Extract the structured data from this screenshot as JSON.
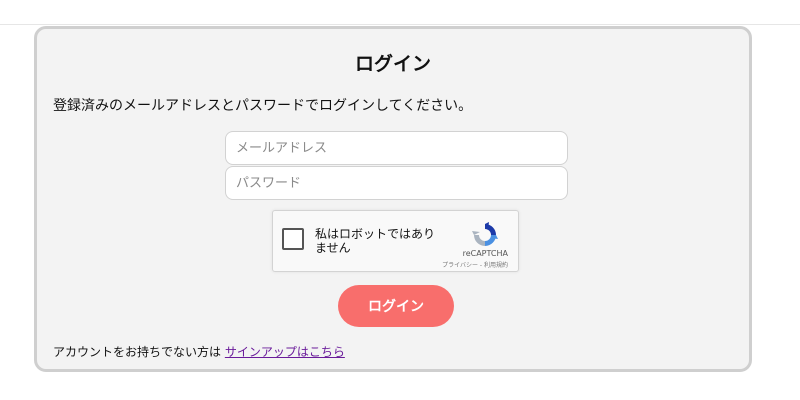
{
  "login": {
    "title": "ログイン",
    "description": "登録済みのメールアドレスとパスワードでログインしてください。",
    "email_placeholder": "メールアドレス",
    "password_placeholder": "パスワード",
    "submit_label": "ログイン",
    "signup_prompt": "アカウントをお持ちでない方は",
    "signup_link": "サインアップはこちら"
  },
  "captcha": {
    "label": "私はロボットではありません",
    "brand": "reCAPTCHA",
    "links": "プライバシー - 利用規約",
    "logo_icon": "recaptcha-logo-icon"
  },
  "colors": {
    "accent": "#f86e6c",
    "link": "#6a1b9a",
    "card_background": "#f3f3f3",
    "card_border": "#cfcfcf"
  }
}
